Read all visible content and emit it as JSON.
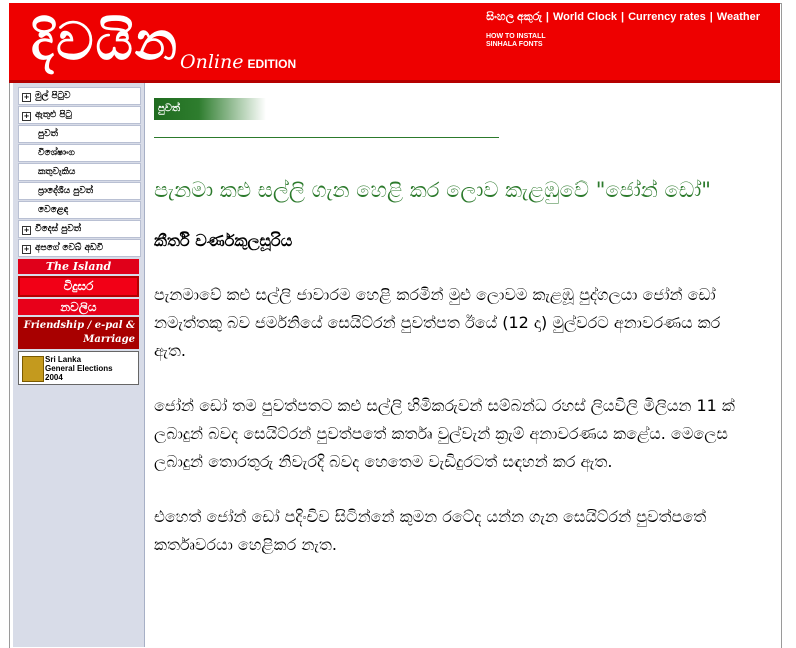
{
  "header": {
    "logo": "දිවයින",
    "edition_online": "Online",
    "edition_label": "EDITION",
    "links": [
      "සිංහල අකුරු",
      "World Clock",
      "Currency rates",
      "Weather"
    ],
    "install_fonts": "HOW TO INSTALL SINHALA FONTS"
  },
  "sidebar": {
    "items": [
      {
        "label": "මුල් පිටුව",
        "box": true
      },
      {
        "label": "ඇතුළු පිටු",
        "box": true
      },
      {
        "label": "පුවත්",
        "box": false
      },
      {
        "label": "විශේෂාංග",
        "box": false
      },
      {
        "label": "කතුවැකිය",
        "box": false
      },
      {
        "label": "ප්‍රාදේශීය පුවත්",
        "box": false
      },
      {
        "label": "වෙළෙඳ",
        "box": false
      },
      {
        "label": "විදෙස් පුවත්",
        "box": true
      },
      {
        "label": "අපගේ වෙබ් අඩවි",
        "box": true
      }
    ],
    "banners": {
      "island": "The Island",
      "vishvasa": "විදුසර",
      "navaliya": "නවලිය",
      "friendship": "Friendship / e-pal & Marriage",
      "elections_line1": "Sri Lanka",
      "elections_line2": "General Elections",
      "elections_line3": "2004"
    }
  },
  "article": {
    "section": "පුවත්",
    "headline": "පැනමා කළු සල්ලි ගැන හෙළි කර ලොව කැළඹුවේ \"ජෝන් ඩෝ\"",
    "author": "කීර්ති වර්ණකුලසූරිය",
    "paragraphs": [
      "පැනමාවේ කළු සල්ලි ජාවාරම හෙළි කරමින් මුළු ලොවම කැළඹූ පුද්ගලයා ජෝන් ඩෝ නමැත්තකු බව ජර්මනියේ සෙයිට්රන් පුවත්පත ඊයේ (12 දා) මුල්වරට අනාවරණය කර ඇත.",
      "ජෝන් ඩෝ තම පුවත්පතට කළු සල්ලි හිමිකරුවන් සම්බන්ධ රහස් ලියවිලි මිලියන 11 ක් ලබාදුන් බවද සෙයිට්රන් පුවත්පතේ කර්තෘ වුල්වැන් ක්‍රැම් අනාවරණය කළේය. මෙලෙස ලබාදුන් තොරතුරු නිවැරදි බවද හෙතෙම වැඩිදුරටත් සඳහන් කර ඇත.",
      "එහෙත් ජෝන් ඩෝ පදිංචිව සිටින්නේ කුමන රටේද යන්න ගැන සෙයිට්රන් පුවත්පතේ කර්තෘවරයා හෙළිකර නැත."
    ]
  }
}
